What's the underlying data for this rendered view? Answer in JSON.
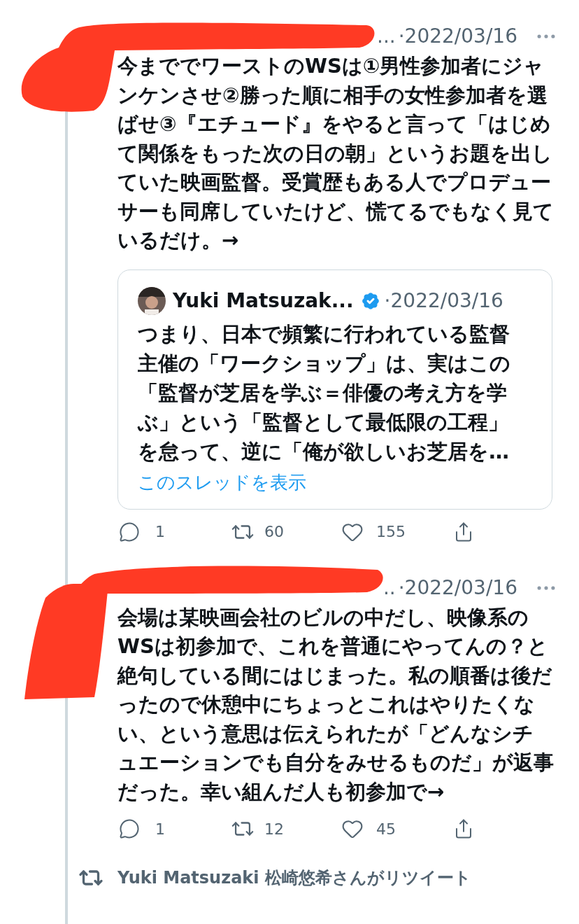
{
  "tweets": [
    {
      "name_tail": "...",
      "separator": "·",
      "date": "2022/03/16",
      "text": "今まででワーストのWSは①男性参加者にジャンケンさせ②勝った順に相手の女性参加者を選ばせ③『エチュード』をやると言って「はじめて関係をもった次の日の朝」というお題を出していた映画監督。受賞歴もある人でプロデューサーも同席していたけど、慌てるでもなく見ているだけ。→",
      "quote": {
        "name": "Yuki Matsuzak...",
        "verified": true,
        "separator": "·",
        "date": "2022/03/16",
        "text": "つまり、日本で頻繁に行われている監督主催の「ワークショップ」は、実はこの「監督が芝居を学ぶ＝俳優の考え方を学ぶ」という「監督として最低限の工程」を怠って、逆に「俺が欲しいお芝居を…",
        "link": "このスレッドを表示"
      },
      "replies": "1",
      "retweets": "60",
      "likes": "155"
    },
    {
      "name_tail": "..",
      "separator": "·",
      "date": "2022/03/16",
      "text": "会場は某映画会社のビルの中だし、映像系のWSは初参加で、これを普通にやってんの？と絶句している間にはじまった。私の順番は後だったので休憩中にちょっとこれはやりたくない、という意思は伝えられたが「どんなシチュエーションでも自分をみせるものだ」が返事だった。幸い組んだ人も初参加で→",
      "replies": "1",
      "retweets": "12",
      "likes": "45"
    }
  ],
  "retweet_notice": "Yuki Matsuzaki 松崎悠希さんがリツイート"
}
